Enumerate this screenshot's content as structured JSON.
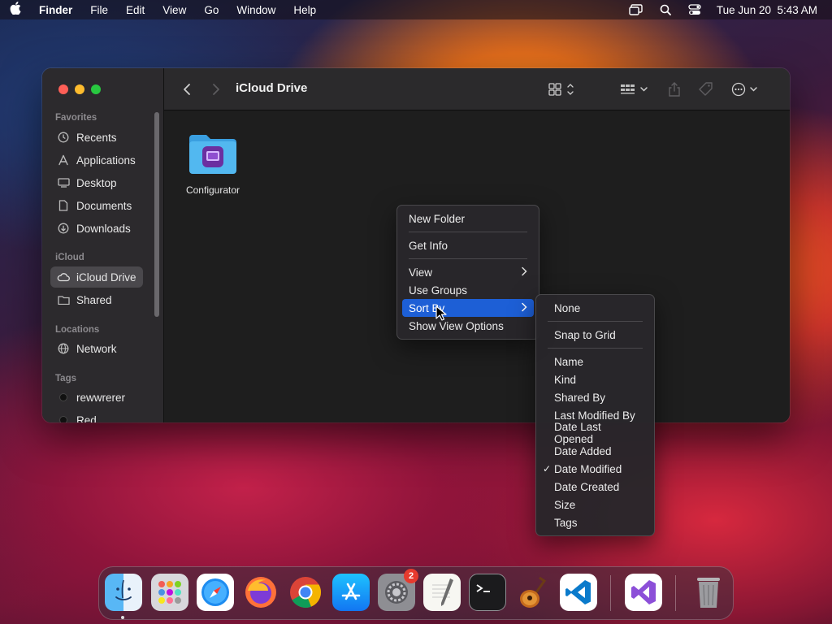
{
  "menubar": {
    "app_name": "Finder",
    "items": [
      "File",
      "Edit",
      "View",
      "Go",
      "Window",
      "Help"
    ],
    "datetime": "Tue Jun 20  5:43 AM"
  },
  "window": {
    "title": "iCloud Drive",
    "sidebar": {
      "favorites_header": "Favorites",
      "favorites": [
        "Recents",
        "Applications",
        "Desktop",
        "Documents",
        "Downloads"
      ],
      "icloud_header": "iCloud",
      "icloud": [
        "iCloud Drive",
        "Shared"
      ],
      "locations_header": "Locations",
      "locations": [
        "Network"
      ],
      "tags_header": "Tags",
      "tags": [
        "rewwrerer",
        "Red"
      ]
    },
    "files": [
      {
        "name": "Configurator"
      }
    ]
  },
  "context_menu": {
    "items": [
      "New Folder",
      "Get Info",
      "View",
      "Use Groups",
      "Sort By",
      "Show View Options"
    ],
    "highlighted": "Sort By"
  },
  "sort_submenu": {
    "items": [
      "None",
      "Snap to Grid",
      "Name",
      "Kind",
      "Shared By",
      "Last Modified By",
      "Date Last Opened",
      "Date Added",
      "Date Modified",
      "Date Created",
      "Size",
      "Tags"
    ],
    "checked": "Date Modified"
  },
  "dock": {
    "apps": [
      "Finder",
      "Launchpad",
      "Safari",
      "Firefox",
      "Chrome",
      "App Store",
      "System Settings",
      "TextEdit",
      "Terminal",
      "GarageBand",
      "Visual Studio Code",
      "Visual Studio",
      "Trash"
    ],
    "system_settings_badge": "2"
  }
}
